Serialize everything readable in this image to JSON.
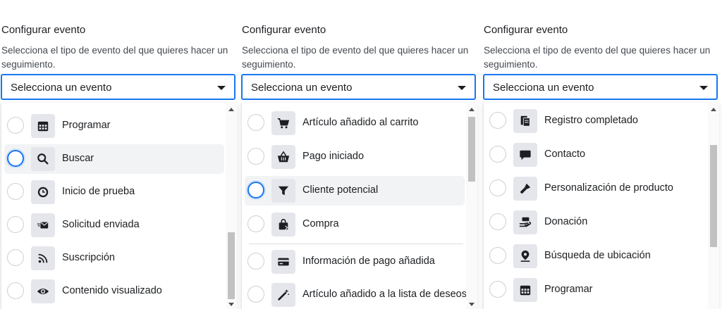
{
  "panels": [
    {
      "title": "Configurar evento",
      "description": "Selecciona el tipo de evento del que quieres hacer un seguimiento.",
      "select_placeholder": "Selecciona un evento",
      "options": [
        {
          "label": "Programar",
          "icon": "calendar-icon"
        },
        {
          "label": "Buscar",
          "icon": "search-icon"
        },
        {
          "label": "Inicio de prueba",
          "icon": "clock-icon"
        },
        {
          "label": "Solicitud enviada",
          "icon": "envelope-send-icon"
        },
        {
          "label": "Suscripción",
          "icon": "rss-icon"
        },
        {
          "label": "Contenido visualizado",
          "icon": "eye-icon"
        }
      ]
    },
    {
      "title": "Configurar evento",
      "description": "Selecciona el tipo de evento del que quieres hacer un seguimiento.",
      "select_placeholder": "Selecciona un evento",
      "options": [
        {
          "label": "Artículo añadido al carrito",
          "icon": "cart-icon"
        },
        {
          "label": "Pago iniciado",
          "icon": "basket-icon"
        },
        {
          "label": "Cliente potencial",
          "icon": "funnel-icon"
        },
        {
          "label": "Compra",
          "icon": "shopping-bag-icon"
        },
        {
          "label": "Información de pago añadida",
          "icon": "credit-card-icon"
        },
        {
          "label": "Artículo añadido a la lista de deseos",
          "icon": "magic-wand-icon"
        }
      ]
    },
    {
      "title": "Configurar evento",
      "description": "Selecciona el tipo de evento del que quieres hacer un seguimiento.",
      "select_placeholder": "Selecciona un evento",
      "options": [
        {
          "label": "Registro completado",
          "icon": "registration-icon"
        },
        {
          "label": "Contacto",
          "icon": "chat-bubble-icon"
        },
        {
          "label": "Personalización de producto",
          "icon": "paint-brush-icon"
        },
        {
          "label": "Donación",
          "icon": "donation-icon"
        },
        {
          "label": "Búsqueda de ubicación",
          "icon": "location-pin-icon"
        },
        {
          "label": "Programar",
          "icon": "calendar-icon"
        }
      ]
    }
  ],
  "colors": {
    "accent": "#1877f2",
    "icon_bg": "#e4e6eb",
    "hover_bg": "#f2f3f5"
  }
}
